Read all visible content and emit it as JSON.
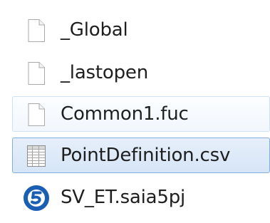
{
  "file_list": {
    "items": [
      {
        "name": "_Global",
        "icon": "blank-file-icon",
        "state": "normal"
      },
      {
        "name": "_lastopen",
        "icon": "blank-file-icon",
        "state": "normal"
      },
      {
        "name": "Common1.fuc",
        "icon": "blank-file-icon",
        "state": "hover"
      },
      {
        "name": "PointDefinition.csv",
        "icon": "spreadsheet-file-icon",
        "state": "selected"
      },
      {
        "name": "SV_ET.saia5pj",
        "icon": "saia-project-icon",
        "state": "normal"
      }
    ]
  },
  "colors": {
    "selected_border": "#84acdd",
    "selected_fill": "#d6e5f7",
    "hover_border": "#cfe0f2",
    "saia_brand_blue": "#1a5fb4"
  }
}
